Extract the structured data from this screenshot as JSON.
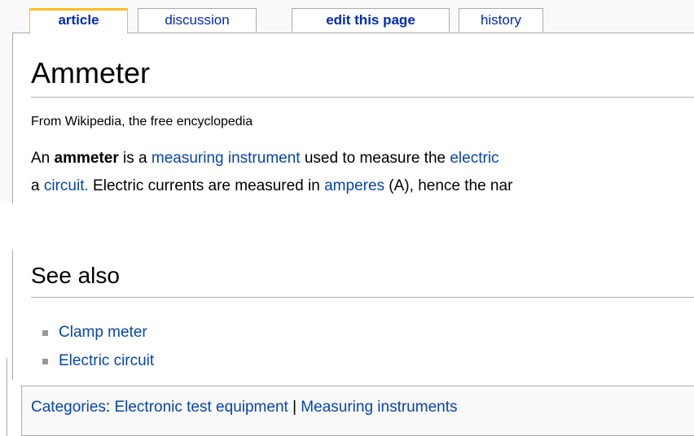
{
  "tabs": [
    {
      "label": "article"
    },
    {
      "label": "discussion"
    },
    {
      "label": "edit this page"
    },
    {
      "label": "history"
    }
  ],
  "page": {
    "title": "Ammeter",
    "site_sub": "From Wikipedia, the free encyclopedia"
  },
  "intro": {
    "line1": {
      "t1": "An ",
      "bold": "ammeter",
      "t2": " is a ",
      "link1": "measuring instrument",
      "t3": " used to measure the ",
      "link2": "electric"
    },
    "line2": {
      "t1": "a ",
      "link1": "circuit.",
      "t2": " Electric currents are measured in ",
      "link2": "amperes",
      "t3": " (A), hence the nar"
    }
  },
  "see_also": {
    "heading": "See also",
    "items": [
      "Clamp meter",
      "Electric circuit"
    ]
  },
  "categories": {
    "label": "Categories",
    "colon": ": ",
    "items": [
      "Electronic test equipment",
      "Measuring instruments"
    ],
    "separator": " | "
  },
  "colors": {
    "link": "#0645ad",
    "tab_link": "#002bb8",
    "selected_tab_accent": "#fabd23",
    "border": "#aaaaaa",
    "panel_bg": "#f9f9f9"
  }
}
